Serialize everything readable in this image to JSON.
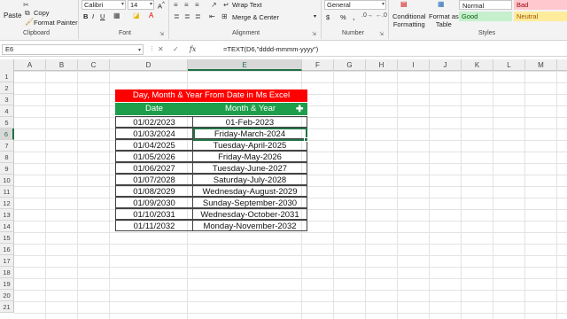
{
  "ribbon": {
    "clipboard": {
      "paste_label": "Paste",
      "copy_label": "Copy",
      "format_painter_label": "Format Painter",
      "group_label": "Clipboard"
    },
    "font": {
      "font_name": "Calibri",
      "font_size": "14",
      "bold": "B",
      "italic": "I",
      "underline": "U",
      "group_label": "Font"
    },
    "alignment": {
      "wrap_text_label": "Wrap Text",
      "merge_center_label": "Merge & Center",
      "group_label": "Alignment"
    },
    "number": {
      "format_value": "General",
      "currency": "$",
      "percent": "%",
      "comma": ",",
      "group_label": "Number"
    },
    "styles": {
      "conditional_formatting_label": "Conditional\nFormatting",
      "format_as_table_label": "Format as\nTable",
      "normal_label": "Normal",
      "bad_label": "Bad",
      "good_label": "Good",
      "neutral_label": "Neutral",
      "group_label": "Styles"
    }
  },
  "formula_bar": {
    "name_box": "E6",
    "fx_label": "fx",
    "cancel_icon": "✕",
    "enter_icon": "✓",
    "formula": "=TEXT(D6,\"dddd-mmmm-yyyy\")"
  },
  "grid": {
    "columns": [
      "A",
      "B",
      "C",
      "D",
      "E",
      "F",
      "G",
      "H",
      "I",
      "J",
      "K",
      "L",
      "M"
    ],
    "rows": [
      "1",
      "2",
      "3",
      "4",
      "5",
      "6",
      "7",
      "8",
      "9",
      "10",
      "11",
      "12",
      "13",
      "14",
      "15",
      "16",
      "17",
      "18",
      "19",
      "20",
      "21"
    ],
    "active_column": "E",
    "active_row": "6"
  },
  "table": {
    "title": "Day, Month & Year From Date in Ms Excel",
    "headers": [
      "Date",
      "Month & Year"
    ],
    "rows": [
      [
        "01/02/2023",
        "01-Feb-2023"
      ],
      [
        "01/03/2024",
        "Friday-March-2024"
      ],
      [
        "01/04/2025",
        "Tuesday-April-2025"
      ],
      [
        "01/05/2026",
        "Friday-May-2026"
      ],
      [
        "01/06/2027",
        "Tuesday-June-2027"
      ],
      [
        "01/07/2028",
        "Saturday-July-2028"
      ],
      [
        "01/08/2029",
        "Wednesday-August-2029"
      ],
      [
        "01/09/2030",
        "Sunday-September-2030"
      ],
      [
        "01/10/2031",
        "Wednesday-October-2031"
      ],
      [
        "01/11/2032",
        "Monday-November-2032"
      ]
    ]
  },
  "colors": {
    "title_bg": "#ff0000",
    "header_bg": "#1e9e4a",
    "selection": "#217346",
    "bad_style": "#ffc7ce",
    "good_style": "#c6efce",
    "neutral_style": "#ffeb9c"
  }
}
